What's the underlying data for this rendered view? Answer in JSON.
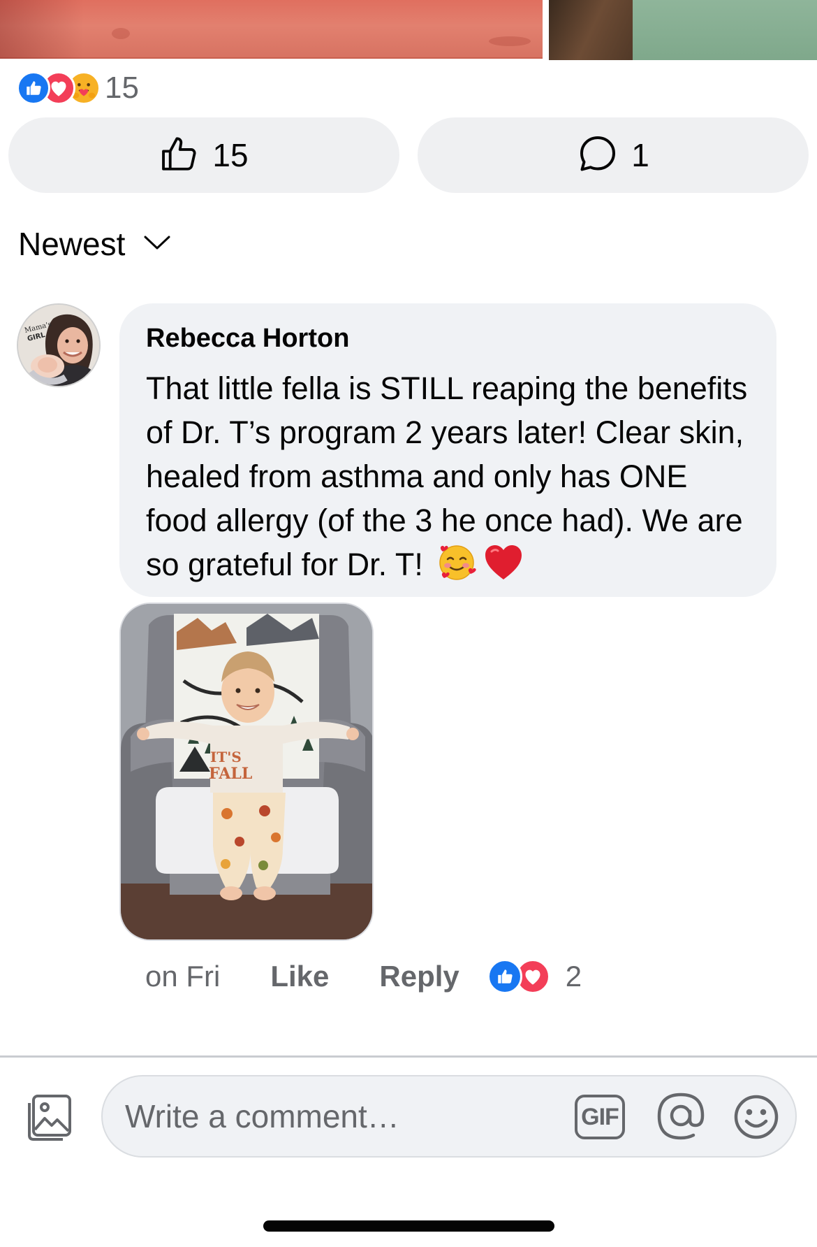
{
  "post": {
    "reaction_count": "15",
    "reaction_icons": [
      "like-icon",
      "love-icon",
      "care-icon"
    ],
    "like_count": "15",
    "comment_count": "1"
  },
  "sort": {
    "label": "Newest"
  },
  "comment": {
    "author": "Rebecca Horton",
    "text": "That little fella is STILL reaping the benefits of Dr. T’s program 2 years later! Clear skin, healed from asthma and only has ONE food allergy (of the 3 he once had). We are so grateful for Dr. T!",
    "emojis": [
      "smiling-face-with-hearts",
      "red-heart"
    ],
    "avatar_badge": "Mama's GIRL",
    "photo_shirt_text": "IT'S FALL",
    "time": "on Fri",
    "like_label": "Like",
    "reply_label": "Reply",
    "reaction_count": "2"
  },
  "composer": {
    "placeholder": "Write a comment…",
    "gif_label": "GIF"
  },
  "colors": {
    "like_blue": "#1877f2",
    "love_red": "#f33e58",
    "bubble_bg": "#f0f2f5",
    "secondary_text": "#65676b"
  }
}
